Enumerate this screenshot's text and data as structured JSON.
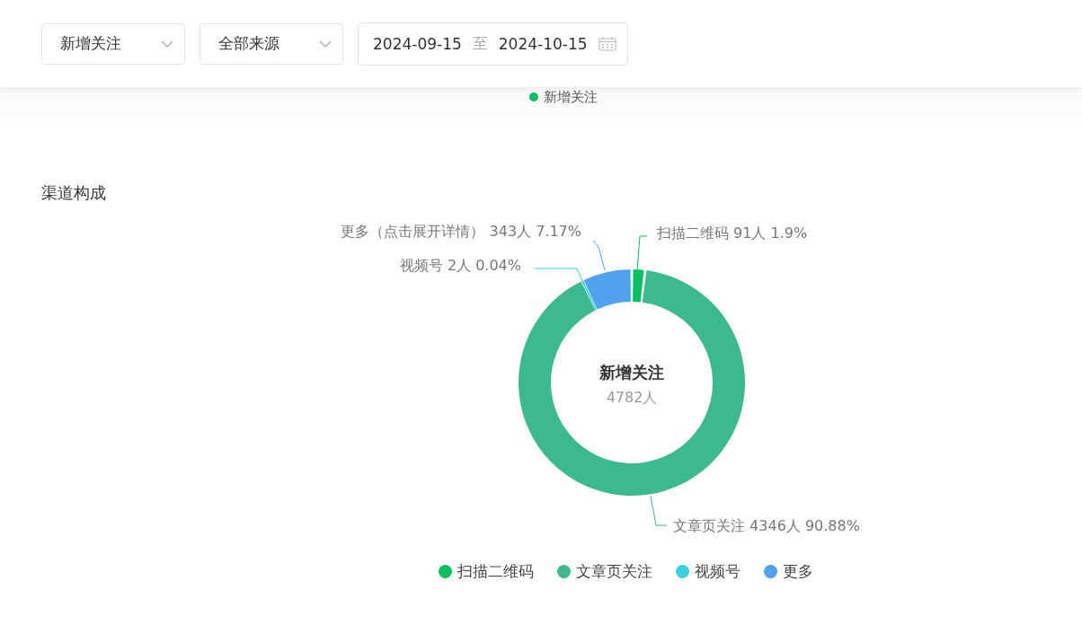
{
  "filters": {
    "metric_select": {
      "value": "新增关注"
    },
    "source_select": {
      "value": "全部来源"
    },
    "date_range": {
      "start": "2024-09-15",
      "separator": "至",
      "end": "2024-10-15"
    }
  },
  "top_legend": {
    "label": "新增关注",
    "color": "#07c160"
  },
  "channel_section": {
    "title": "渠道构成",
    "center": {
      "title": "新增关注",
      "count": "4782人"
    },
    "chart_data": {
      "type": "donut",
      "categories": [
        "扫描二维码",
        "文章页关注",
        "视频号",
        "更多（点击展开详情）"
      ],
      "values": [
        1.9,
        90.88,
        0.04,
        7.17
      ],
      "data_labels": "value_labels",
      "value_labels": [
        "91人 1.9%",
        "4346人 90.88%",
        "2人 0.04%",
        "343人 7.17%"
      ]
    },
    "legend": [
      {
        "label": "扫描二维码",
        "color": "#07c160"
      },
      {
        "label": "文章页关注",
        "color": "#3cb98f"
      },
      {
        "label": "视频号",
        "color": "#3ccfe0"
      },
      {
        "label": "更多",
        "color": "#4ea3ec"
      }
    ]
  }
}
